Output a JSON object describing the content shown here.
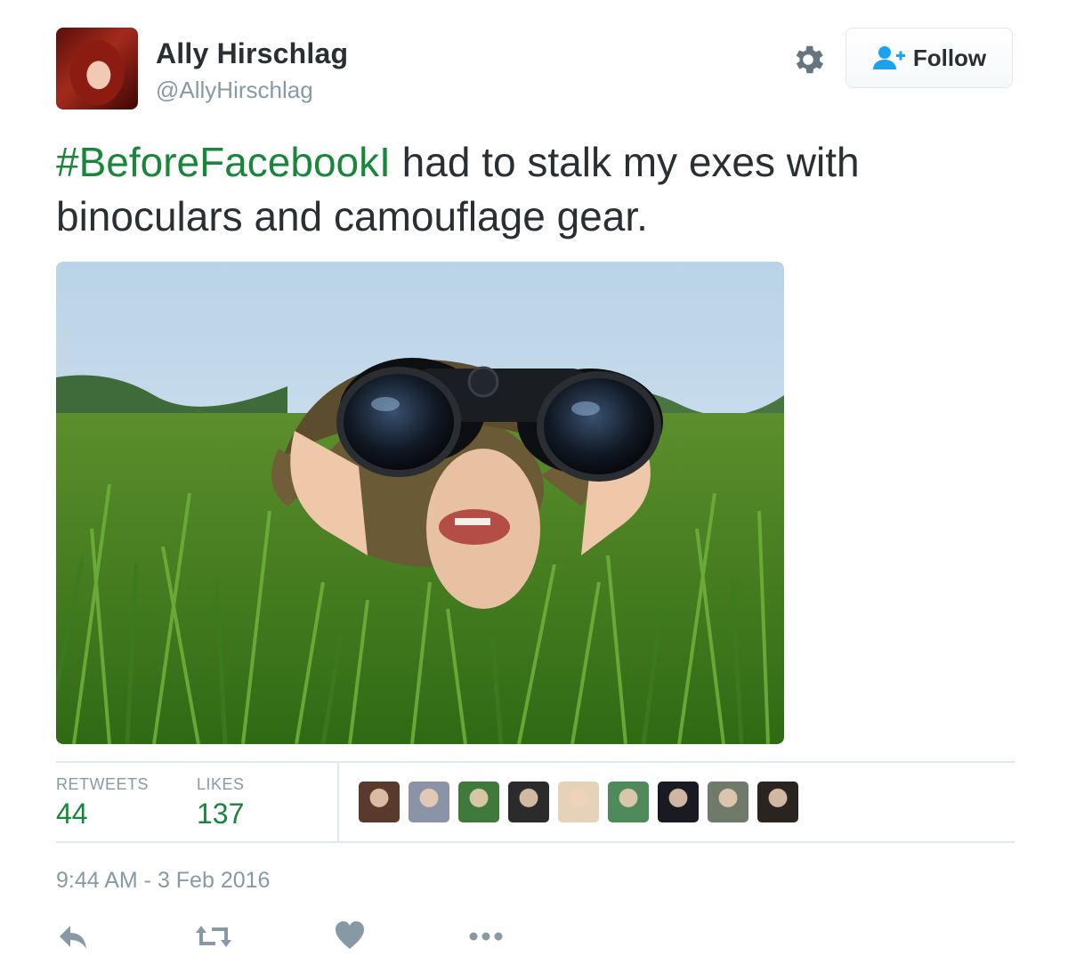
{
  "author": {
    "display_name": "Ally Hirschlag",
    "handle": "@AllyHirschlag"
  },
  "header": {
    "follow_label": "Follow",
    "settings_icon": "gear-icon",
    "follow_icon": "add-user-icon"
  },
  "tweet": {
    "hashtag": "#BeforeFacebookI",
    "text": " had to stalk my exes with binoculars and camouflage gear."
  },
  "stats": {
    "retweets_label": "RETWEETS",
    "retweets_count": "44",
    "likes_label": "LIKES",
    "likes_count": "137"
  },
  "likers": [
    {
      "icon": "liker-avatar",
      "color": "#5a3a2c"
    },
    {
      "icon": "liker-avatar",
      "color": "#8a94a6"
    },
    {
      "icon": "liker-avatar",
      "color": "#3f7a3a"
    },
    {
      "icon": "liker-avatar",
      "color": "#2b2b2b"
    },
    {
      "icon": "liker-avatar",
      "color": "#e6d2b8"
    },
    {
      "icon": "liker-avatar",
      "color": "#4e8a5a"
    },
    {
      "icon": "liker-avatar",
      "color": "#1a1a22"
    },
    {
      "icon": "liker-avatar",
      "color": "#6f7a6a"
    },
    {
      "icon": "liker-avatar",
      "color": "#2a2420"
    }
  ],
  "timestamp": "9:44 AM - 3 Feb 2016",
  "actions": [
    "reply-icon",
    "retweet-icon",
    "like-icon",
    "more-icon"
  ],
  "colors": {
    "hashtag": "#19863b",
    "counts": "#19863b",
    "muted": "#8899a6",
    "text": "#292f33"
  }
}
